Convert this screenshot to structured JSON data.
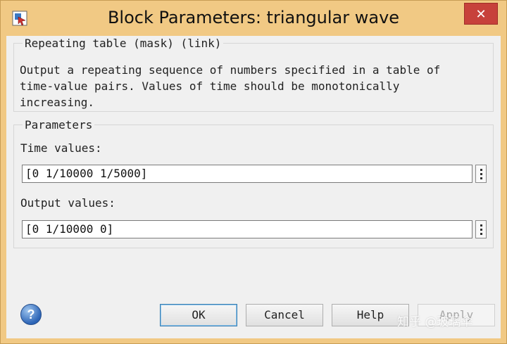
{
  "window": {
    "title": "Block Parameters: triangular wave",
    "close_label": "✕"
  },
  "mask_group": {
    "legend": "Repeating table (mask) (link)",
    "description": "Output a repeating sequence of numbers specified in a table of time-value pairs. Values of time should be monotonically increasing."
  },
  "parameters": {
    "legend": "Parameters",
    "time_label": "Time values:",
    "time_value": "[0 1/10000 1/5000]",
    "output_label": "Output values:",
    "output_value": "[0 1/10000 0]"
  },
  "buttons": {
    "help_icon": "?",
    "ok": "OK",
    "cancel": "Cancel",
    "help": "Help",
    "apply": "Apply"
  },
  "watermark": "知乎 @玻璃伞",
  "colors": {
    "title_bar": "#f1c984",
    "close_button": "#c7413b",
    "client_bg": "#f0f0f0"
  }
}
